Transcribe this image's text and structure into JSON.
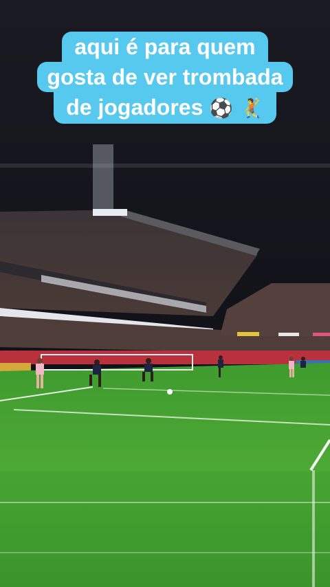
{
  "caption": {
    "line1": "aqui é para quem",
    "line2": "gosta de ver trombada",
    "line3": "de jogadores",
    "emojis": "⚽ 🤾"
  }
}
